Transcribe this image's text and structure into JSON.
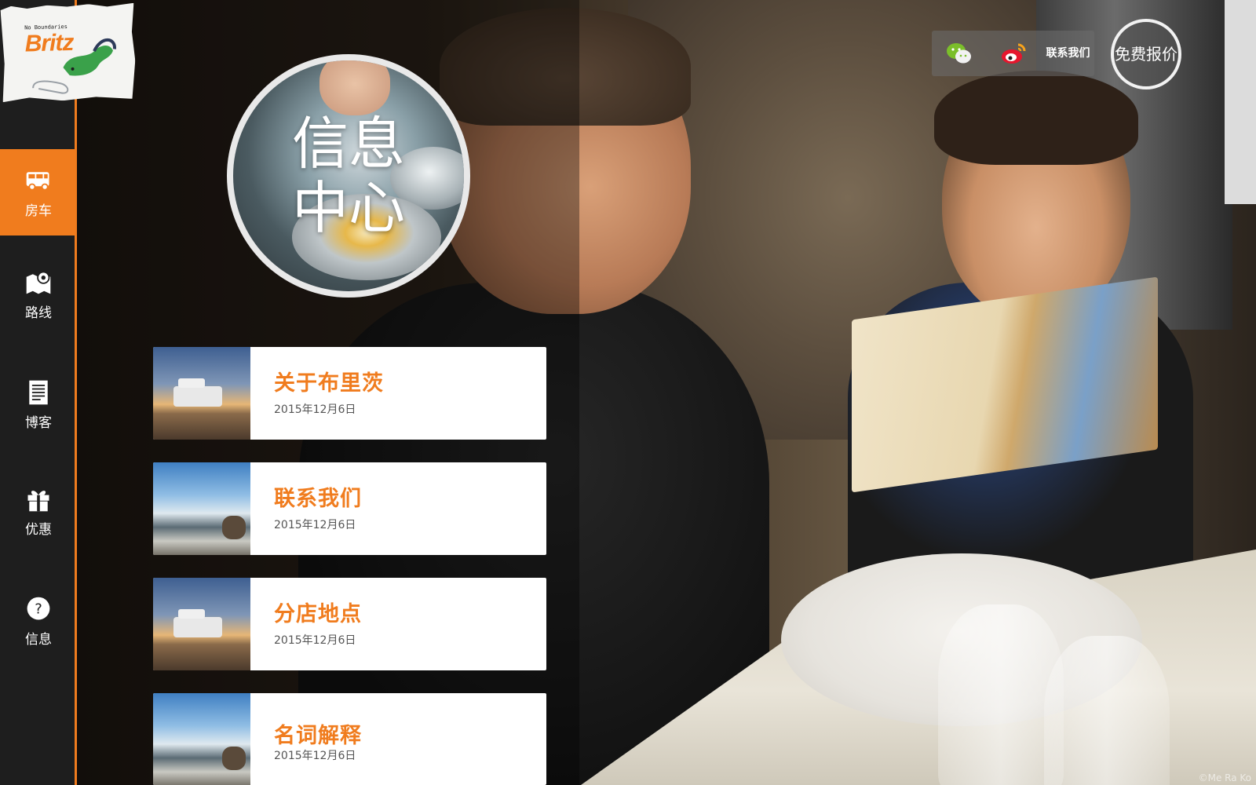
{
  "brand": {
    "tagline": "No Boundaries",
    "name": "Britz"
  },
  "sidebar": {
    "items": [
      {
        "label": "房车",
        "icon": "campervan-icon",
        "active": true
      },
      {
        "label": "路线",
        "icon": "map-pin-icon",
        "active": false
      },
      {
        "label": "博客",
        "icon": "document-icon",
        "active": false
      },
      {
        "label": "优惠",
        "icon": "gift-icon",
        "active": false
      },
      {
        "label": "信息",
        "icon": "question-icon",
        "active": false
      }
    ]
  },
  "header": {
    "social": [
      {
        "icon": "wechat-icon"
      },
      {
        "icon": "weibo-icon"
      }
    ],
    "contact_label": "联系我们",
    "quote_label": "免费报价"
  },
  "hero": {
    "title": "信息中心"
  },
  "articles": [
    {
      "title": "关于布里茨",
      "date": "2015年12月6日",
      "thumb": "sunset-campervan"
    },
    {
      "title": "联系我们",
      "date": "2015年12月6日",
      "thumb": "seaside"
    },
    {
      "title": "分店地点",
      "date": "2015年12月6日",
      "thumb": "sunset-campervan"
    },
    {
      "title": "名词解释",
      "date": "2015年12月6日",
      "thumb": "seaside"
    }
  ],
  "photo_credit": "©Me Ra Ko",
  "colors": {
    "accent": "#f07c1e",
    "sidebar": "#1e1e1e",
    "card": "#ffffff"
  }
}
